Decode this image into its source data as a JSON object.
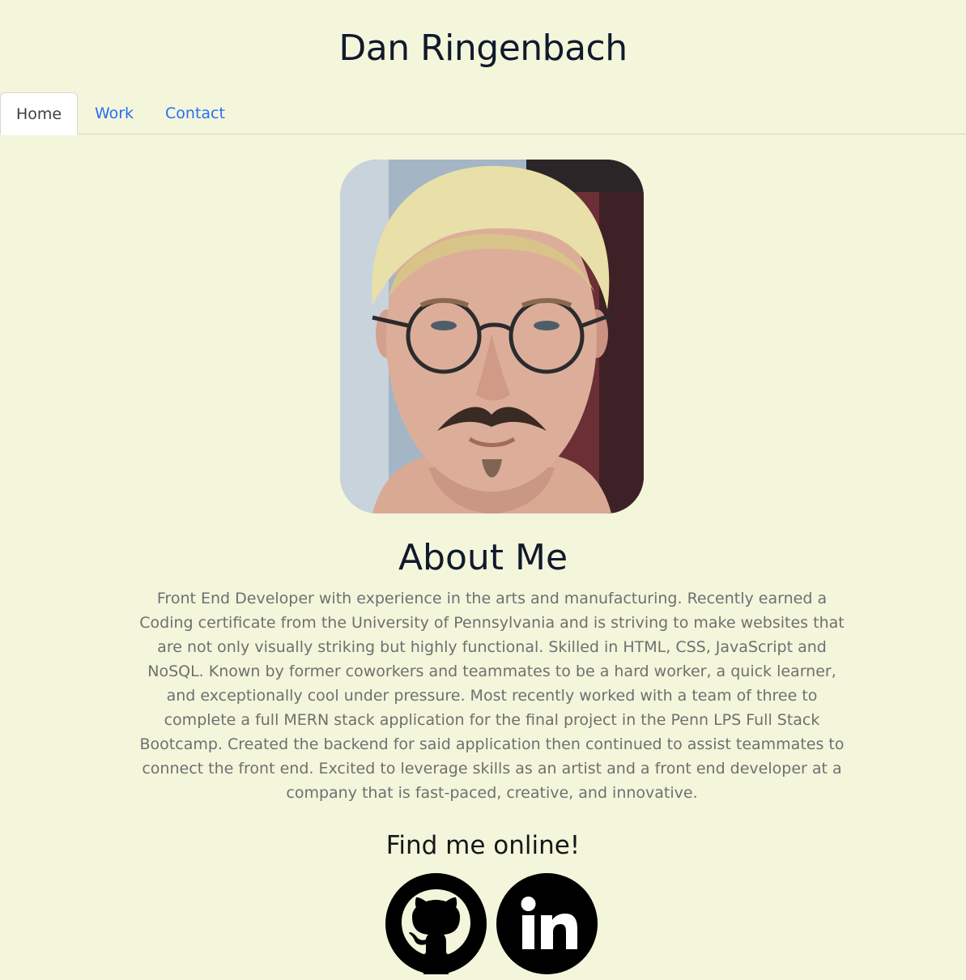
{
  "header": {
    "title": "Dan Ringenbach"
  },
  "nav": {
    "tabs": [
      {
        "label": "Home",
        "active": true
      },
      {
        "label": "Work",
        "active": false
      },
      {
        "label": "Contact",
        "active": false
      }
    ]
  },
  "portrait": {
    "icon": "profile-photo"
  },
  "about": {
    "heading": "About Me",
    "body": "Front End Developer with experience in the arts and manufacturing. Recently earned a Coding certificate from the University of Pennsylvania and is striving to make websites that are not only visually striking but highly functional. Skilled in HTML, CSS, JavaScript and NoSQL. Known by former coworkers and teammates to be a hard worker, a quick learner, and exceptionally cool under pressure. Most recently worked with a team of three to complete a full MERN stack application for the final project in the Penn LPS Full Stack Bootcamp. Created the backend for said application then continued to assist teammates to connect the front end. Excited to leverage skills as an artist and a front end developer at a company that is fast-paced, creative, and innovative."
  },
  "social": {
    "heading": "Find me online!",
    "links": [
      {
        "icon": "github-icon"
      },
      {
        "icon": "linkedin-icon"
      }
    ]
  },
  "colors": {
    "background": "#f4f6dc",
    "link": "#2a6df4",
    "heading": "#111a2c",
    "body_text": "#6d706f"
  }
}
